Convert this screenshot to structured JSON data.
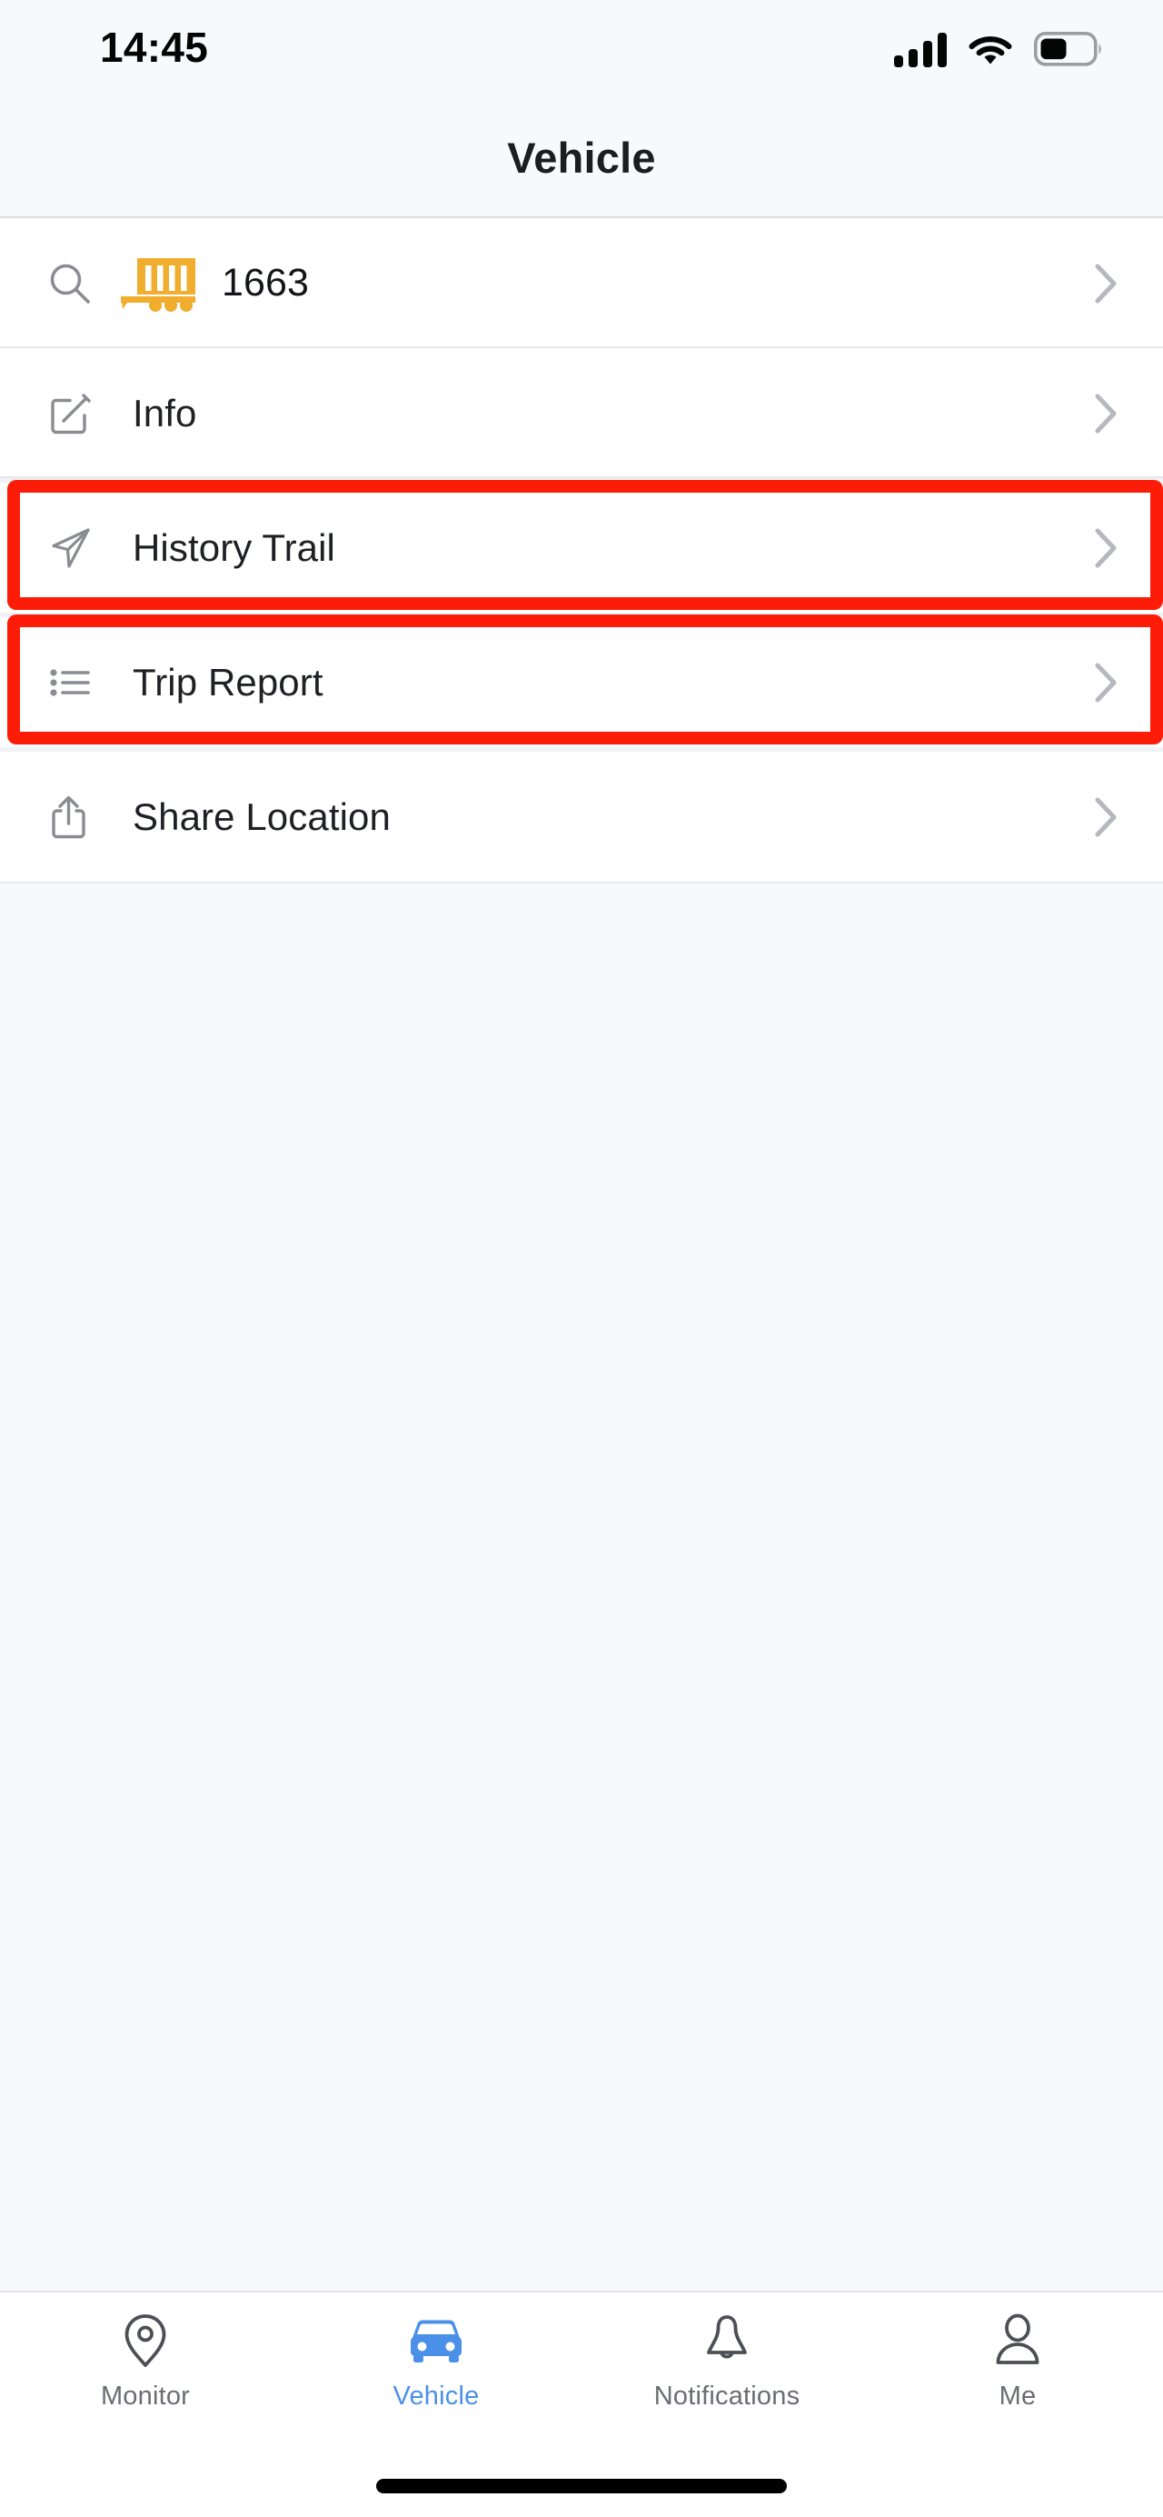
{
  "status_bar": {
    "time": "14:45",
    "signal_icon": "cellular-signal-icon",
    "signal_bars_total": 4,
    "signal_bars_filled": 4,
    "wifi_icon": "wifi-icon",
    "battery_icon": "battery-icon",
    "battery_percent": 45
  },
  "header": {
    "title": "Vehicle"
  },
  "colors": {
    "accent_blue": "#4a90e8",
    "annotation_red": "#fd1c08",
    "trailer_amber": "#f0ad2e",
    "page_background": "#f8f9fc",
    "row_background": "#ffffff",
    "icon_gray": "#8a8c91",
    "text_primary": "#1f2024",
    "text_muted": "#6b6d73"
  },
  "list": {
    "rows": [
      {
        "id": "vehicle-search",
        "icon": "search-icon",
        "vehicle_icon": "livestock-trailer-icon",
        "label": "1663",
        "chevron": "chevron-right-icon",
        "highlighted": false
      },
      {
        "id": "info",
        "icon": "edit-square-icon",
        "label": "Info",
        "chevron": "chevron-right-icon",
        "highlighted": false
      },
      {
        "id": "history-trail",
        "icon": "navigation-arrow-icon",
        "label": "History Trail",
        "chevron": "chevron-right-icon",
        "highlighted": true
      },
      {
        "id": "trip-report",
        "icon": "bulleted-list-icon",
        "label": "Trip Report",
        "chevron": "chevron-right-icon",
        "highlighted": true
      },
      {
        "id": "share-location",
        "icon": "share-up-icon",
        "label": "Share Location",
        "chevron": "chevron-right-icon",
        "highlighted": false
      }
    ]
  },
  "tab_bar": {
    "tabs": [
      {
        "id": "monitor",
        "label": "Monitor",
        "icon": "map-pin-icon",
        "active": false
      },
      {
        "id": "vehicle",
        "label": "Vehicle",
        "icon": "car-front-icon",
        "active": true
      },
      {
        "id": "notifications",
        "label": "Notifications",
        "icon": "bell-icon",
        "active": false
      },
      {
        "id": "me",
        "label": "Me",
        "icon": "person-icon",
        "active": false
      }
    ]
  },
  "home_indicator": {
    "name": "home-indicator"
  }
}
